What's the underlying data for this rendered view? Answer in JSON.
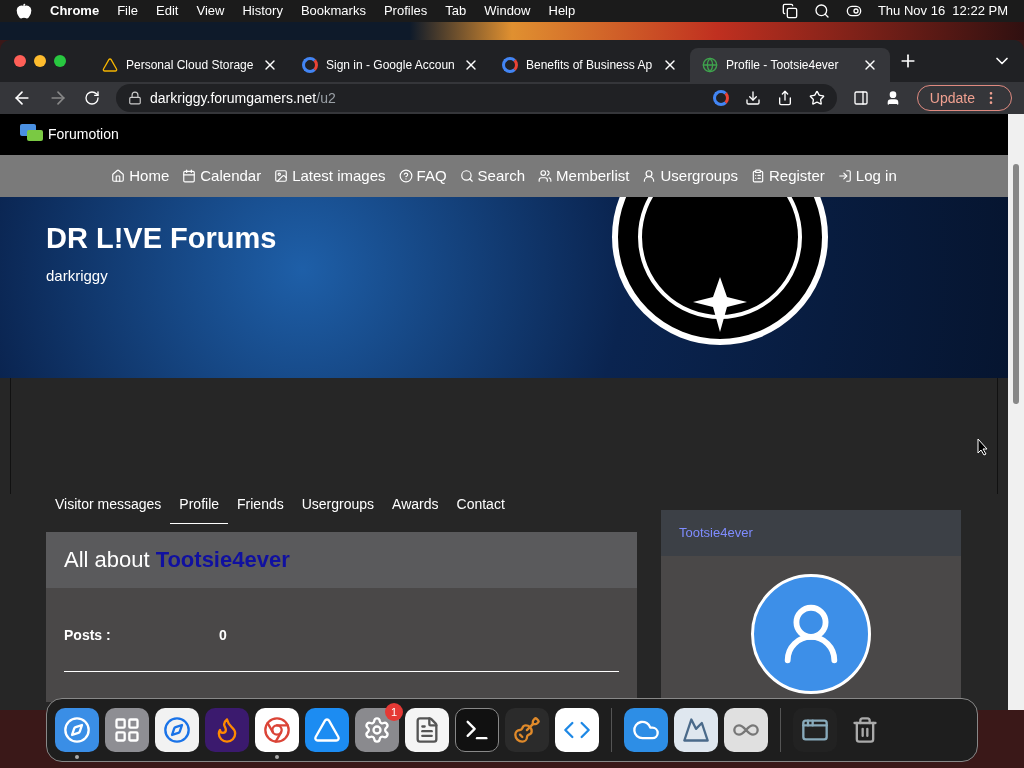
{
  "menubar": {
    "app": "Chrome",
    "items": [
      "File",
      "Edit",
      "View",
      "History",
      "Bookmarks",
      "Profiles",
      "Tab",
      "Window",
      "Help"
    ],
    "clock": "Thu Nov 16  12:22 PM"
  },
  "browser_tabs": [
    {
      "title": "Personal Cloud Storage",
      "kind": "drive",
      "selected": false
    },
    {
      "title": "Sign in - Google Accoun",
      "kind": "google",
      "selected": false
    },
    {
      "title": "Benefits of Business Ap",
      "kind": "google",
      "selected": false
    },
    {
      "title": "Profile - Tootsie4ever",
      "kind": "globe",
      "selected": true
    }
  ],
  "address": {
    "host": "darkriggy.forumgamers.net",
    "path": "/u2"
  },
  "update_button": "Update",
  "site": {
    "logo": "Forumotion",
    "nav": [
      {
        "label": "Home",
        "kind": "home"
      },
      {
        "label": "Calendar",
        "kind": "calendar"
      },
      {
        "label": "Latest images",
        "kind": "images"
      },
      {
        "label": "FAQ",
        "kind": "faq"
      },
      {
        "label": "Search",
        "kind": "search"
      },
      {
        "label": "Memberlist",
        "kind": "members"
      },
      {
        "label": "Usergroups",
        "kind": "groups"
      },
      {
        "label": "Register",
        "kind": "register"
      },
      {
        "label": "Log in",
        "kind": "login"
      }
    ],
    "forum_title": "DR L!VE Forums",
    "forum_subtitle": "darkriggy"
  },
  "profile_tabs": [
    {
      "label": "Visitor messages",
      "selected": false
    },
    {
      "label": "Profile",
      "selected": true
    },
    {
      "label": "Friends",
      "selected": false
    },
    {
      "label": "Usergroups",
      "selected": false
    },
    {
      "label": "Awards",
      "selected": false
    },
    {
      "label": "Contact",
      "selected": false
    }
  ],
  "about": {
    "heading": "All about",
    "username": "Tootsie4ever",
    "fields": [
      {
        "label": "Posts :",
        "value": "0"
      }
    ]
  },
  "side_panel": {
    "username": "Tootsie4ever"
  },
  "dock": [
    {
      "kind": "finder",
      "running": true
    },
    {
      "kind": "launchpad",
      "running": false
    },
    {
      "kind": "safari",
      "running": false
    },
    {
      "kind": "firefox",
      "running": false
    },
    {
      "kind": "chrome",
      "running": true
    },
    {
      "kind": "appstore",
      "running": false
    },
    {
      "kind": "settings",
      "running": false,
      "badge": "1"
    },
    {
      "kind": "textedit",
      "running": false
    },
    {
      "kind": "terminal",
      "running": false
    },
    {
      "kind": "garageband",
      "running": false
    },
    {
      "kind": "vscode",
      "running": false
    },
    {
      "kind": "separator"
    },
    {
      "kind": "weather",
      "running": false
    },
    {
      "kind": "preview",
      "running": false
    },
    {
      "kind": "cloud",
      "running": false
    },
    {
      "kind": "separator"
    },
    {
      "kind": "window",
      "running": false
    },
    {
      "kind": "trash",
      "running": false
    }
  ]
}
